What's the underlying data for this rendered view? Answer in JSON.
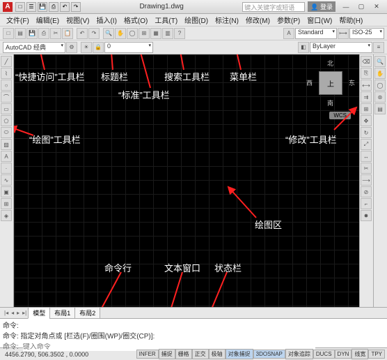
{
  "titlebar": {
    "doc_name": "Drawing1.dwg",
    "search_placeholder": "键入关键字或短语",
    "login_label": "登录"
  },
  "menus": [
    "文件(F)",
    "编辑(E)",
    "视图(V)",
    "插入(I)",
    "格式(O)",
    "工具(T)",
    "绘图(D)",
    "标注(N)",
    "修改(M)",
    "参数(P)",
    "窗口(W)",
    "帮助(H)"
  ],
  "workspace": {
    "combo": "AutoCAD 经典"
  },
  "styles": {
    "text_style": "Standard",
    "dim_style": "ISO-25"
  },
  "layer": {
    "combo": "ByLayer"
  },
  "viewcube": {
    "top": "上",
    "n": "北",
    "s": "南",
    "e": "东",
    "w": "西",
    "wcs": "WCS"
  },
  "tabs": {
    "model": "模型",
    "layout1": "布局1",
    "layout2": "布局2"
  },
  "command": {
    "line1": "命令:",
    "line2": "命令: 指定对角点或 [栏选(F)/圈围(WP)/圈交(CP)]:",
    "prompt": "命令:",
    "input_placeholder": "键入命令"
  },
  "status": {
    "coords": "4456.2790, 506.3502 , 0.0000",
    "buttons": [
      "INFER",
      "捕捉",
      "栅格",
      "正交",
      "极轴",
      "对象捕捉",
      "3DOSNAP",
      "对象追踪",
      "DUCS",
      "DYN",
      "线宽",
      "TPY"
    ]
  },
  "annotations": {
    "quick_access": "“快捷访问”工具栏",
    "title_bar": "标题栏",
    "search_bar": "搜索工具栏",
    "menu_bar": "菜单栏",
    "standard_bar": "“标准”工具栏",
    "draw_bar": "“绘图”工具栏",
    "modify_bar": "“修改”工具栏",
    "drawing_area": "绘图区",
    "text_window": "文本窗口",
    "command_line": "命令行",
    "status_bar": "状态栏"
  }
}
